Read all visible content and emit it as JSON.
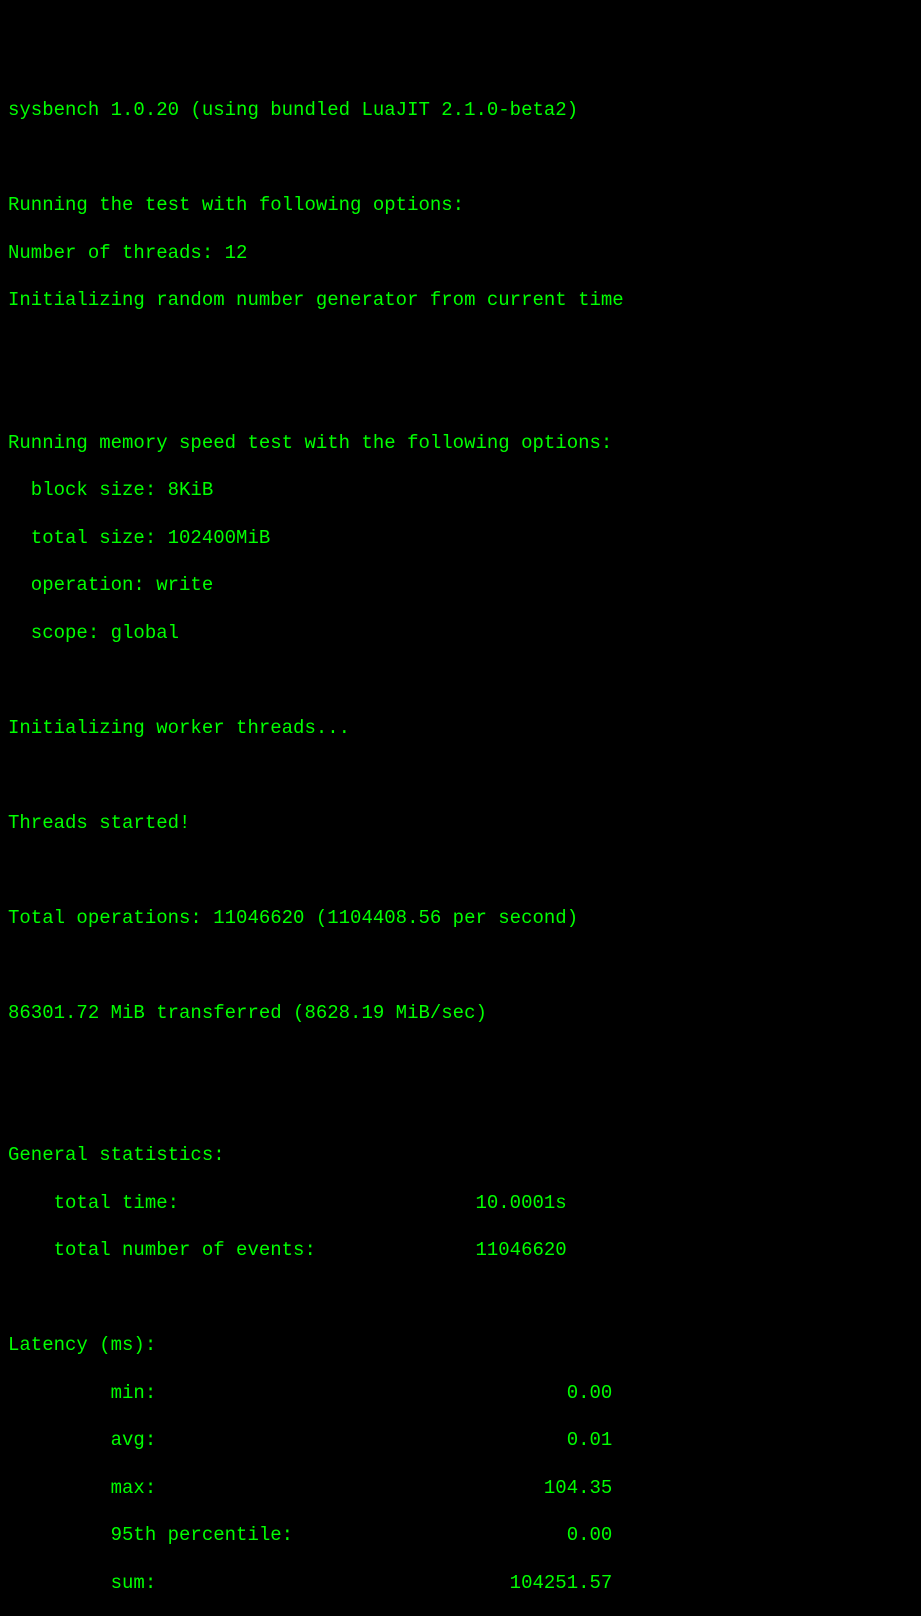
{
  "header": {
    "version_line": "sysbench 1.0.20 (using bundled LuaJIT 2.1.0-beta2)"
  },
  "run_options": {
    "heading": "Running the test with following options:",
    "threads_line": "Number of threads: 12",
    "rng_line": "Initializing random number generator from current time"
  },
  "memory_test": {
    "heading": "Running memory speed test with the following options:",
    "block_size": "  block size: 8KiB",
    "total_size": "  total size: 102400MiB",
    "operation": "  operation: write",
    "scope": "  scope: global"
  },
  "init_workers": "Initializing worker threads...",
  "threads_started": "Threads started!",
  "total_ops": "Total operations: 11046620 (1104408.56 per second)",
  "transferred": "86301.72 MiB transferred (8628.19 MiB/sec)",
  "general_stats": {
    "heading": "General statistics:",
    "total_time": "    total time:                          10.0001s",
    "total_events": "    total number of events:              11046620"
  },
  "latency": {
    "heading": "Latency (ms):",
    "min": "         min:                                    0.00",
    "avg": "         avg:                                    0.01",
    "max": "         max:                                  104.35",
    "p95": "         95th percentile:                        0.00",
    "sum": "         sum:                               104251.57"
  }
}
